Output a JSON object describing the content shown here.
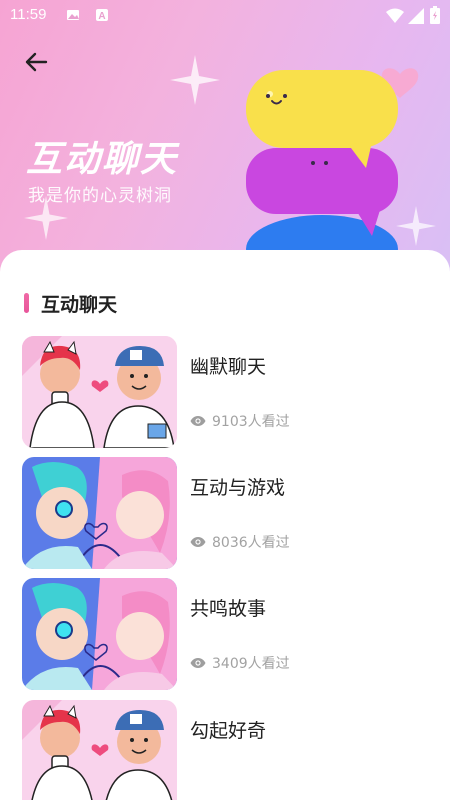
{
  "status_bar": {
    "time": "11:59"
  },
  "hero": {
    "title": "互动聊天",
    "subtitle": "我是你的心灵树洞"
  },
  "section": {
    "title": "互动聊天"
  },
  "items": [
    {
      "title": "幽默聊天",
      "views": "9103人看过",
      "art": "couple-cartoon"
    },
    {
      "title": "互动与游戏",
      "views": "8036人看过",
      "art": "anime-kiss"
    },
    {
      "title": "共鸣故事",
      "views": "3409人看过",
      "art": "anime-kiss"
    },
    {
      "title": "勾起好奇",
      "views": "",
      "art": "couple-cartoon"
    }
  ],
  "colors": {
    "accent": "#e8559a",
    "bubble_yellow": "#f9e04b",
    "bubble_purple": "#c947e0",
    "bubble_blue": "#2d7cf0"
  },
  "icons": [
    "back-arrow-icon",
    "eye-icon",
    "wifi-icon",
    "signal-icon",
    "battery-icon"
  ]
}
